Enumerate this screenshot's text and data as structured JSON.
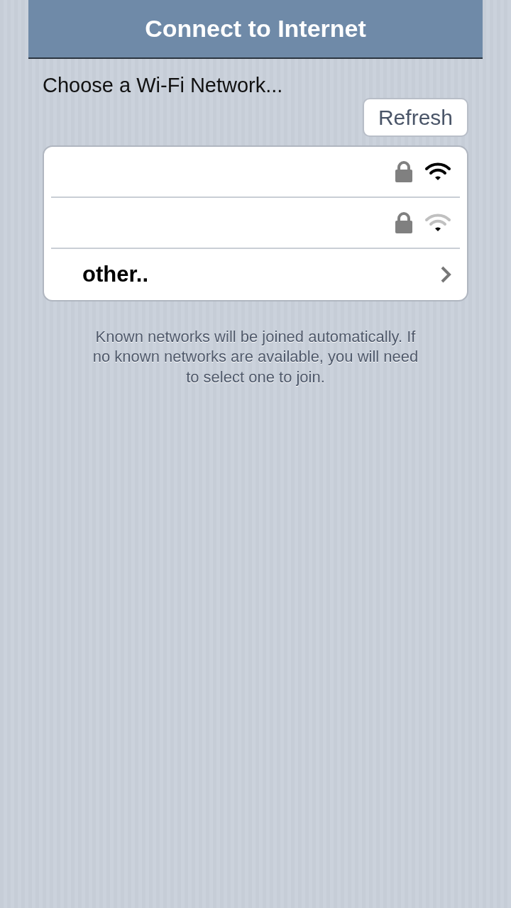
{
  "header": {
    "title": "Connect to Internet"
  },
  "prompt": "Choose a Wi-Fi Network...",
  "refresh_button": "Refresh",
  "networks": [
    {
      "kind": "network",
      "locked": true,
      "weak": false
    },
    {
      "kind": "network",
      "locked": true,
      "weak": true
    },
    {
      "kind": "other",
      "label": "other.."
    }
  ],
  "note": "Known networks will be joined automatically. If no known networks are available, you will need to select one to join."
}
